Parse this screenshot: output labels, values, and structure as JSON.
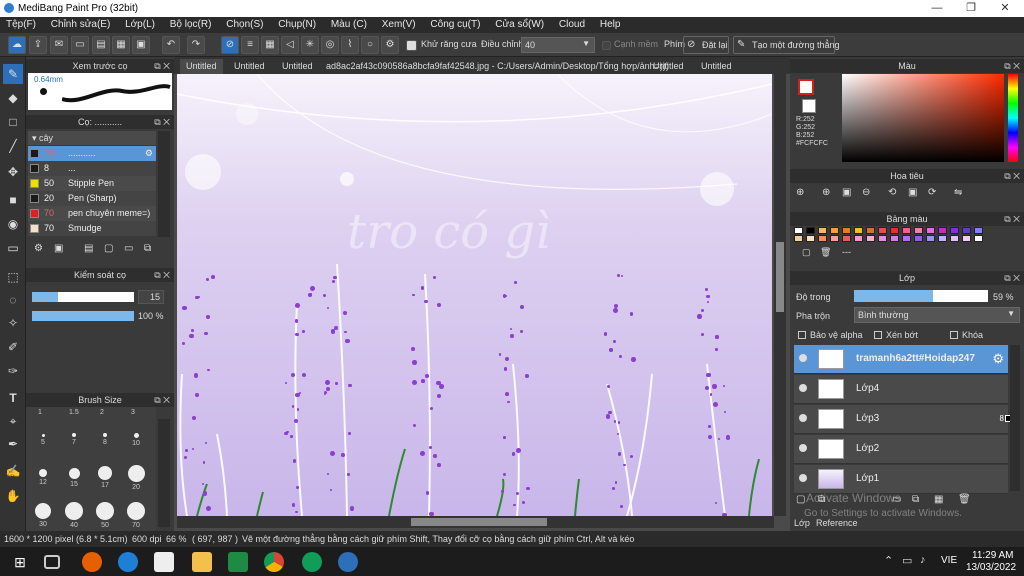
{
  "app": {
    "title": "MediBang Paint Pro (32bit)"
  },
  "window_controls": {
    "minimize": "—",
    "maximize": "❐",
    "close": "✕"
  },
  "menu": [
    "Tệp(F)",
    "Chỉnh sửa(E)",
    "Lớp(L)",
    "Bộ lọc(R)",
    "Chọn(S)",
    "Chụp(N)",
    "Màu (C)",
    "Xem(V)",
    "Công cụ(T)",
    "Cửa sổ(W)",
    "Cloud",
    "Help"
  ],
  "toolbar": {
    "antialias_label": "Khử răng cưa",
    "adjust_label": "Điều chỉnh",
    "adjust_value": "40",
    "smooth_label": "Cạnh mềm",
    "key_label": "Phím",
    "reset_label": "Đặt lại",
    "line_label": "Tạo một đường thẳng"
  },
  "preview_panel": {
    "title": "Xem trước cọ",
    "size": "0.64mm"
  },
  "brush_panel": {
    "title": "Cọ: ...........",
    "group": "cây",
    "items": [
      {
        "size": "15",
        "name": "...........",
        "color": "#1a1a1a",
        "selected": true
      },
      {
        "size": "8",
        "name": "...",
        "color": "#1a1a1a",
        "selected": false
      },
      {
        "size": "50",
        "name": "Stipple Pen",
        "color": "#f0e000",
        "selected": false
      },
      {
        "size": "20",
        "name": "Pen (Sharp)",
        "color": "#1a1a1a",
        "selected": false
      },
      {
        "size": "70",
        "name": "pen chuyên meme=)",
        "color": "#e02020",
        "selected": false
      },
      {
        "size": "70",
        "name": "Smudge",
        "color": "#f5e0c8",
        "selected": false
      }
    ]
  },
  "brush_control": {
    "title": "Kiểm soát cọ",
    "size_value": "15",
    "opacity_value": "100 %",
    "size_fraction": 0.25,
    "opacity_fraction": 1.0
  },
  "brush_size_panel": {
    "title": "Brush Size",
    "top_labels": [
      "1",
      "1.5",
      "2",
      "3"
    ],
    "rows": [
      {
        "labels": [
          "5",
          "7",
          "8",
          "10"
        ]
      },
      {
        "labels": [
          "12",
          "15",
          "17",
          "20"
        ]
      },
      {
        "labels": [
          "30",
          "40",
          "50",
          "70"
        ]
      }
    ]
  },
  "tabs": [
    "Untitled",
    "Untitled",
    "Untitled",
    "ad8ac2af43c090586a8bcfa9faf42548.jpg - C:/Users/Admin/Desktop/Tổng hợp/ảnh=)))",
    "Untitled",
    "Untitled"
  ],
  "canvas": {
    "text": "tro có gì"
  },
  "color_panel": {
    "title": "Màu",
    "r": "R:252",
    "g": "G:252",
    "b": "B:252",
    "hex": "#FCFCFC"
  },
  "navigator_panel": {
    "title": "Hoa tiêu"
  },
  "palette_panel": {
    "title": "Bảng màu",
    "row1": [
      "#ffffff",
      "#000000",
      "#f4b870",
      "#f0a040",
      "#e08020",
      "#f0c020",
      "#c87830",
      "#e05050",
      "#e03030",
      "#f06090",
      "#f080b0",
      "#e070e0",
      "#c030c0",
      "#8030e0",
      "#6040c0",
      "#8080ff"
    ],
    "row2": [
      "#f0d0a0",
      "#f8e0c0",
      "#f09060",
      "#f0a0a0",
      "#e06060",
      "#f0a0c0",
      "#f0b0d0",
      "#e090e0",
      "#d080e0",
      "#b070f0",
      "#9060e0",
      "#a090f0",
      "#c0b0ff",
      "#e0c0ff",
      "#f0d0ff",
      "#ffffff"
    ],
    "extra": "---"
  },
  "layer_panel": {
    "title": "Lớp",
    "opacity_label": "Độ trong",
    "opacity_value": "59 %",
    "opacity_fraction": 0.59,
    "blend_label": "Pha trộn",
    "blend_value": "Bình thường",
    "protect_alpha": "Bảo vệ alpha",
    "clipping": "Xén bớt",
    "lock": "Khóa",
    "layers": [
      {
        "name": "tramanh6a2tt#Hoidap247",
        "selected": true
      },
      {
        "name": "Lớp4",
        "selected": false
      },
      {
        "name": "Lớp3",
        "selected": false,
        "badge": "8"
      },
      {
        "name": "Lớp2",
        "selected": false
      },
      {
        "name": "Lớp1",
        "selected": false
      }
    ],
    "bottom_tabs": [
      "Lớp",
      "Reference"
    ]
  },
  "activate": {
    "line1": "Activate Windows",
    "line2": "Go to Settings to activate Windows."
  },
  "status": {
    "image_size": "1600 * 1200 pixel",
    "phys_size": "(6.8 * 5.1cm)",
    "dpi": "600 dpi",
    "zoom": "66 %",
    "coords": "( 697, 987 )",
    "hint": "Vẽ một đường thẳng bằng cách giữ phím Shift, Thay đổi cỡ cọ bằng cách giữ phím Ctrl, Alt và kéo"
  },
  "taskbar": {
    "lang": "VIE",
    "time": "11:29 AM",
    "date": "13/03/2022"
  }
}
